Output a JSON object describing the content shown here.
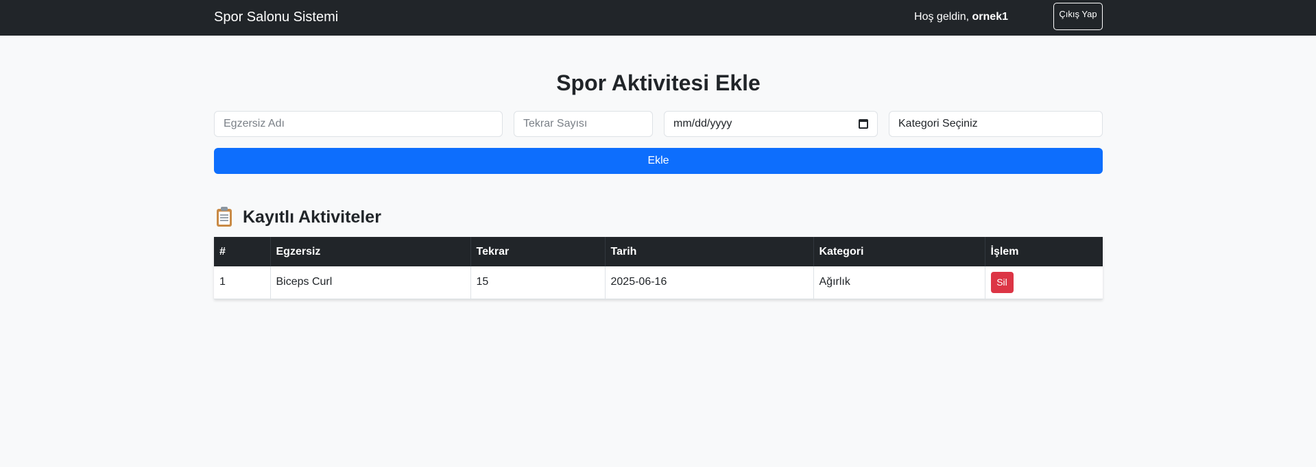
{
  "navbar": {
    "brand": "Spor Salonu Sistemi",
    "welcome_prefix": "Hoş geldin,",
    "username": "ornek1",
    "logout_label": "Çıkış Yap"
  },
  "form": {
    "title": "Spor Aktivitesi Ekle",
    "exercise_placeholder": "Egzersiz Adı",
    "reps_placeholder": "Tekrar Sayısı",
    "date_placeholder": "mm/dd/yyyy",
    "category_selected": "Kategori Seçiniz",
    "submit_label": "Ekle"
  },
  "activities": {
    "title": "Kayıtlı Aktiviteler",
    "icon": "clipboard-icon",
    "columns": [
      "#",
      "Egzersiz",
      "Tekrar",
      "Tarih",
      "Kategori",
      "İşlem"
    ],
    "rows": [
      {
        "index": "1",
        "exercise": "Biceps Curl",
        "reps": "15",
        "date": "2025-06-16",
        "category": "Ağırlık",
        "action_label": "Sil"
      }
    ]
  },
  "colors": {
    "navbar_bg": "#212529",
    "primary": "#0d6efd",
    "danger": "#dc3545",
    "page_bg": "#f8f9fa"
  }
}
